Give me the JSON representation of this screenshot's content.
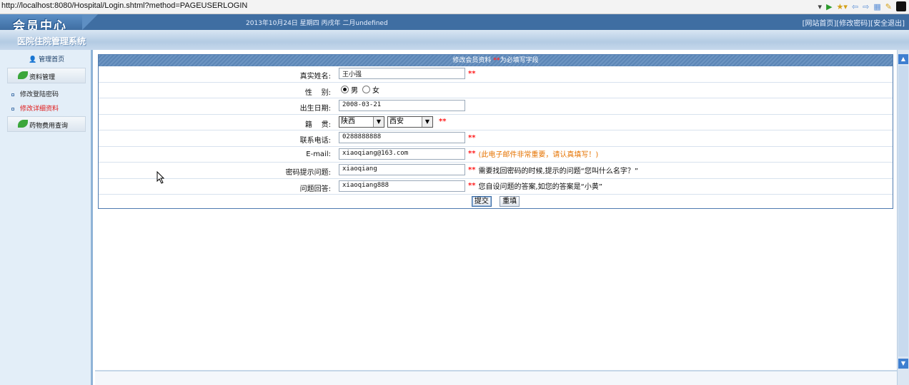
{
  "browser": {
    "url": "http://localhost:8080/Hospital/Login.shtml?method=PAGEUSERLOGIN"
  },
  "header": {
    "logo": "会员中心",
    "date": "2013年10月24日 星期四 丙戌年 二月undefined",
    "links": [
      "[网站首页]",
      "[修改密码]",
      "[安全退出]"
    ],
    "system_name": "医院住院管理系统"
  },
  "sidebar": {
    "home": "管理首页",
    "sections": [
      {
        "label": "资料管理"
      },
      {
        "label": "药物费用查询"
      }
    ],
    "items": [
      {
        "label": "修改登陆密码"
      },
      {
        "label": "修改详细资料"
      }
    ]
  },
  "form": {
    "title": "修改会员资料",
    "title_req": "**",
    "title_suffix": "为必填写字段",
    "rows": {
      "name": {
        "label": "真实姓名:",
        "value": "王小强"
      },
      "gender": {
        "label": "性    别:",
        "male": "男",
        "female": "女",
        "selected": "男"
      },
      "birth": {
        "label": "出生日期:",
        "value": "2008-03-21"
      },
      "native": {
        "label": "籍    贯:",
        "province": "陕西",
        "city": "西安"
      },
      "phone": {
        "label": "联系电话:",
        "value": "0288888888"
      },
      "email": {
        "label": "E-mail:",
        "value": "xiaoqiang@163.com",
        "hint": "(此电子邮件非常重要，请认真填写！)"
      },
      "pwd_q": {
        "label": "密码提示问题:",
        "value": "xiaoqiang",
        "hint": "需要找回密码的时候,提示的问题“您叫什么名字？”"
      },
      "pwd_a": {
        "label": "问题回答:",
        "value": "xiaoqiang888",
        "hint": "您自设问题的答案,如您的答案是“小黄”"
      }
    },
    "required_mark": "**",
    "submit": "提交",
    "reset": "重填"
  }
}
